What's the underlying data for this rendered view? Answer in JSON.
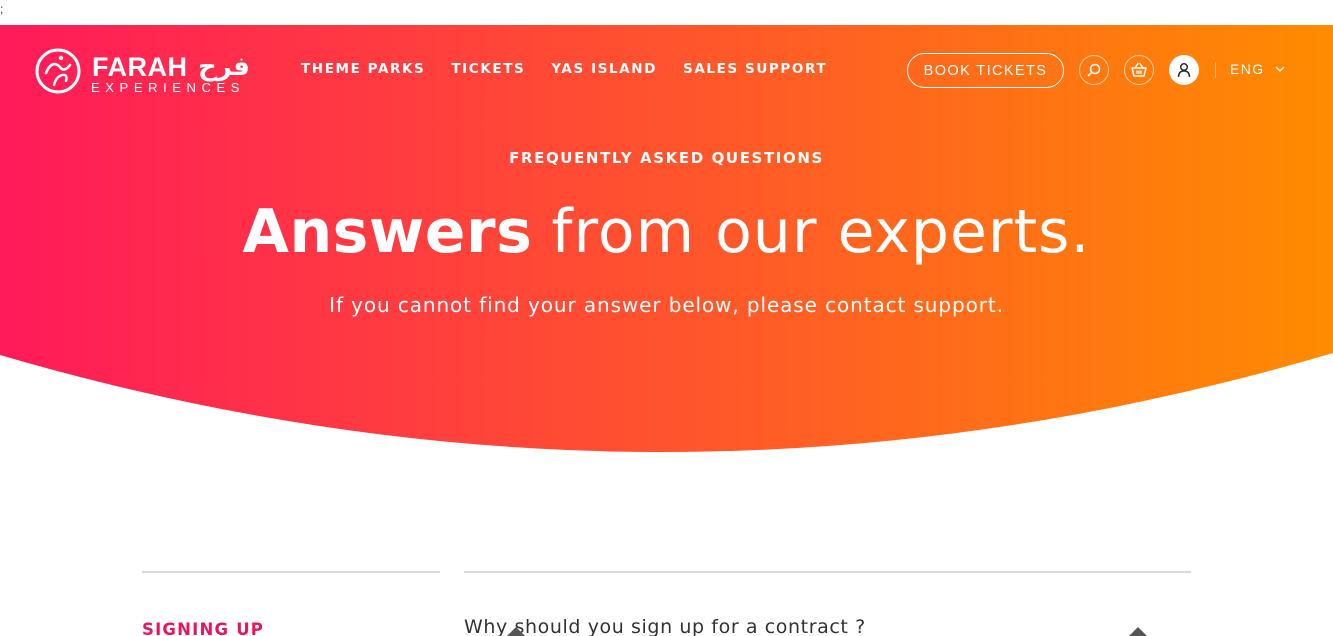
{
  "stray_text": ";",
  "brand": {
    "name": "FARAH",
    "arabic": "فرح",
    "tagline": "EXPERIENCES"
  },
  "nav": {
    "items": [
      {
        "label": "THEME PARKS"
      },
      {
        "label": "TICKETS"
      },
      {
        "label": "YAS ISLAND"
      },
      {
        "label": "SALES SUPPORT"
      }
    ]
  },
  "header": {
    "book_label": "BOOK TICKETS",
    "language": "ENG",
    "icons": {
      "search": "search-icon",
      "cart": "basket-icon",
      "account": "user-icon",
      "language": "chevron-down-icon"
    }
  },
  "hero": {
    "eyebrow": "FREQUENTLY ASKED QUESTIONS",
    "headline_bold": "Answers",
    "headline_light": "from our experts.",
    "subline": "If you cannot find your answer below, please contact support."
  },
  "faq": {
    "category": "SIGNING UP",
    "question": "Why should you sign up for a contract ?"
  },
  "colors": {
    "gradient_start": "#ff1a5a",
    "gradient_end": "#ff8c00",
    "accent": "#e8175d"
  }
}
